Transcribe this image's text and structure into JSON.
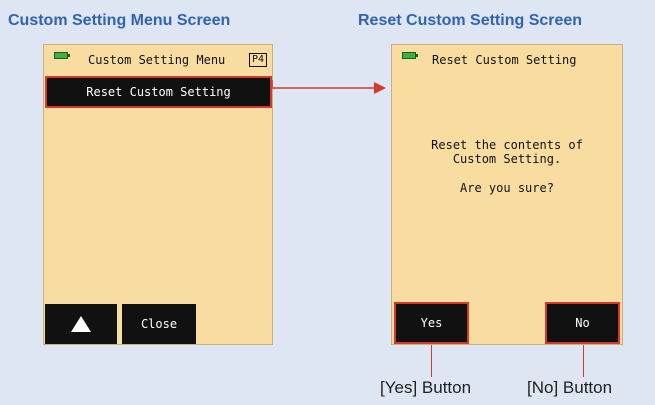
{
  "titles": {
    "left": "Custom Setting Menu Screen",
    "right": "Reset Custom Setting Screen"
  },
  "left_screen": {
    "header_title": "Custom Setting Menu",
    "page_indicator": "P4",
    "menu_item": "Reset Custom Setting",
    "up_button_icon": "up-triangle-icon",
    "close_label": "Close"
  },
  "right_screen": {
    "header_title": "Reset Custom Setting",
    "message_line1": "Reset the contents of",
    "message_line2": "Custom Setting.",
    "question": "Are you sure?",
    "yes_label": "Yes",
    "no_label": "No"
  },
  "callouts": {
    "yes": "[Yes] Button",
    "no": "[No] Button"
  },
  "colors": {
    "background": "#dde6f2",
    "title_blue": "#2f63b4",
    "screen_bg": "#f9dda0",
    "accent_red": "#d23a2e",
    "button_black": "#111111",
    "battery_green": "#3cb043"
  }
}
